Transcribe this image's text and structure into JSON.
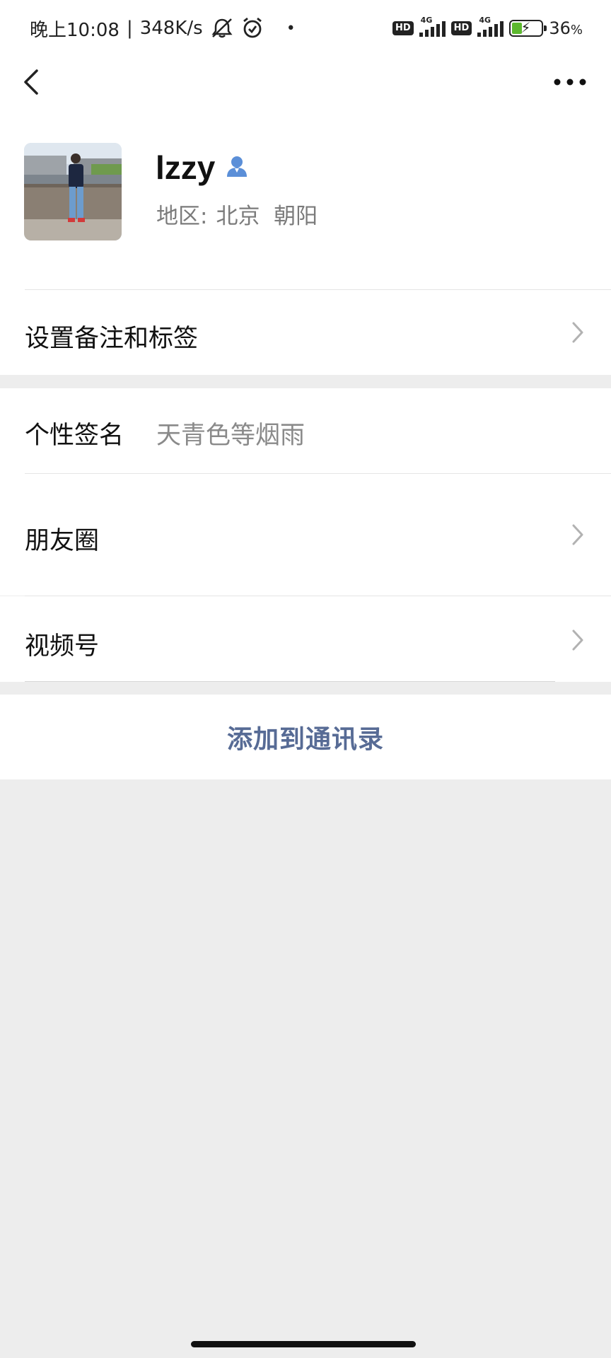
{
  "status_bar": {
    "time": "晚上10:08",
    "separator": "|",
    "speed": "348K/s",
    "hd_1": "HD",
    "net_1": "4G",
    "hd_2": "HD",
    "net_2": "4G",
    "battery_percent": "36",
    "battery_unit": "%",
    "battery_level": 0.36,
    "icons": [
      "mute-bell-icon",
      "alarm-icon",
      "dot-icon",
      "signal-icon",
      "battery-charging-icon"
    ]
  },
  "nav": {
    "icons": [
      "back-arrow-icon",
      "more-dots-icon"
    ]
  },
  "profile": {
    "name": "lzzy",
    "region_label": "地区:",
    "region_value": "北京  朝阳",
    "icons": [
      "person-icon"
    ]
  },
  "menu": {
    "remarks_label": "设置备注和标签",
    "signature_label": "个性签名",
    "signature_value": "天青色等烟雨",
    "moments_label": "朋友圈",
    "channels_label": "视频号"
  },
  "actions": {
    "add_contact_label": "添加到通讯录"
  },
  "colors": {
    "link_blue": "#576b95",
    "background": "#ededed",
    "icon_blue": "#5b8fd8"
  }
}
